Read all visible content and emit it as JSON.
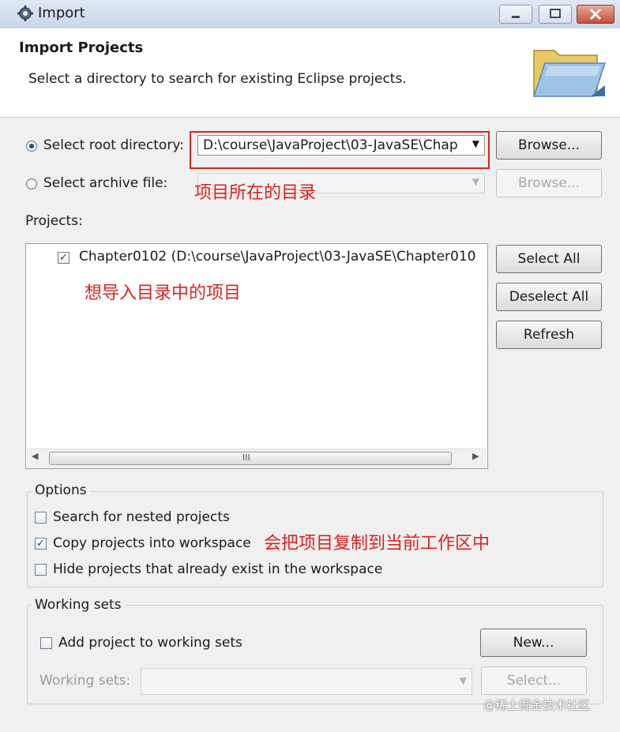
{
  "window": {
    "title": "Import",
    "icon": "gear-icon"
  },
  "header": {
    "title": "Import Projects",
    "description": "Select a directory to search for existing Eclipse projects.",
    "icon": "folder-icon"
  },
  "source": {
    "root_label": "Select root directory:",
    "root_selected": true,
    "root_value": "D:\\course\\JavaProject\\03-JavaSE\\Chap",
    "root_browse": "Browse...",
    "archive_label": "Select archive file:",
    "archive_selected": false,
    "archive_browse": "Browse..."
  },
  "projects": {
    "label": "Projects:",
    "items": [
      {
        "label": "Chapter0102 (D:\\course\\JavaProject\\03-JavaSE\\Chapter010",
        "checked": true
      }
    ],
    "select_all": "Select All",
    "deselect_all": "Deselect All",
    "refresh": "Refresh",
    "scroll_grip": "III"
  },
  "options": {
    "title": "Options",
    "nested": {
      "label": "Search for nested projects",
      "checked": false
    },
    "copy": {
      "label": "Copy projects into workspace",
      "checked": true
    },
    "hide": {
      "label": "Hide projects that already exist in the workspace",
      "checked": false
    }
  },
  "working_sets": {
    "title": "Working sets",
    "add": {
      "label": "Add project to working sets",
      "checked": false
    },
    "new_button": "New...",
    "sets_label": "Working sets:",
    "select_button": "Select..."
  },
  "annotations": {
    "directory": "项目所在的目录",
    "import": "想导入目录中的项目",
    "copy": "会把项目复制到当前工作区中"
  },
  "watermark": "@稀土掘金技术社区",
  "colors": {
    "annotation": "#e02020",
    "accent": "#2b4a78"
  }
}
